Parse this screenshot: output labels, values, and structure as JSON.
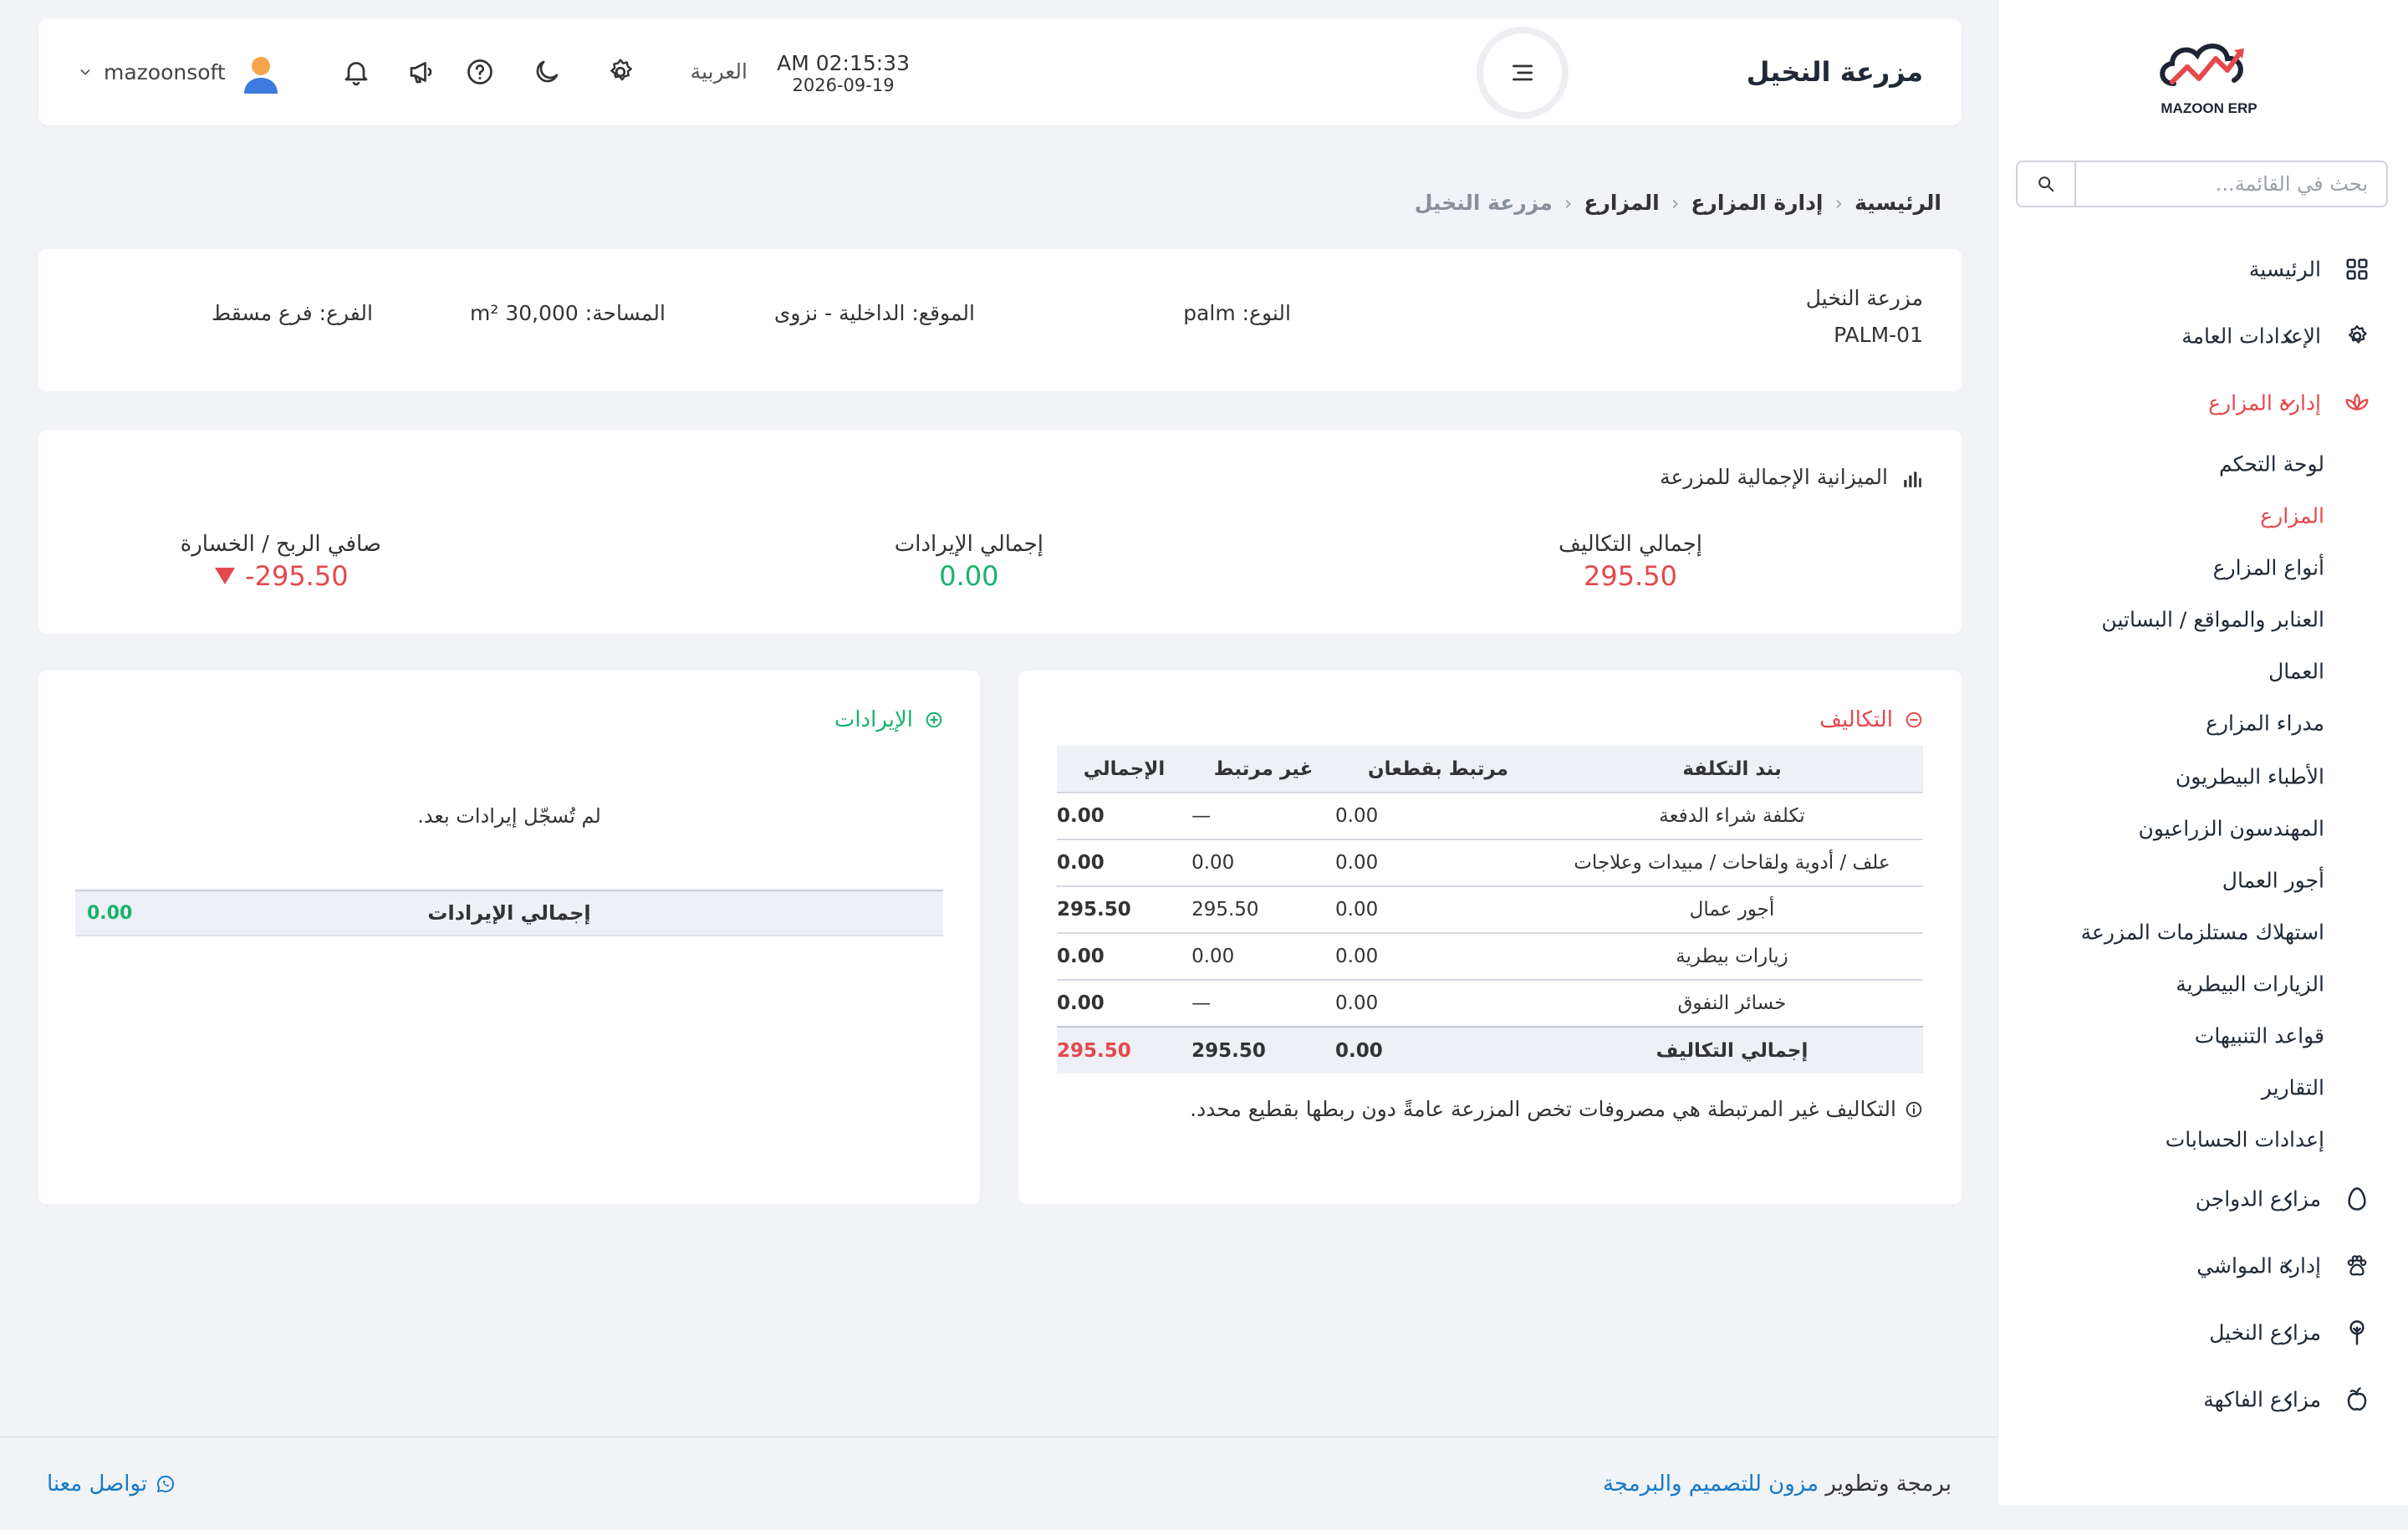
{
  "brand": {
    "logo_text": "MAZOON ERP",
    "accent": "#e5484d"
  },
  "sidebar": {
    "search_placeholder": "بحث في القائمة...",
    "items": [
      {
        "label": "الرئيسية",
        "icon": "grid-icon"
      },
      {
        "label": "الإعدادات العامة",
        "icon": "gear-icon",
        "has_children": true
      },
      {
        "label": "إدارة المزارع",
        "icon": "lotus-icon",
        "expanded": true
      },
      {
        "label": "مزارع الدواجن",
        "icon": "egg-icon",
        "has_children": true
      },
      {
        "label": "إدارة المواشي",
        "icon": "paw-icon",
        "has_children": true
      },
      {
        "label": "مزارع النخيل",
        "icon": "palm-icon",
        "has_children": true
      },
      {
        "label": "مزارع الفاكهة",
        "icon": "fruit-icon",
        "has_children": true
      }
    ],
    "subitems": [
      "لوحة التحكم",
      "المزارع",
      "أنواع المزارع",
      "العنابر والمواقع / البساتين",
      "العمال",
      "مدراء المزارع",
      "الأطباء البيطريون",
      "المهندسون الزراعيون",
      "أجور العمال",
      "استهلاك مستلزمات المزرعة",
      "الزيارات البيطرية",
      "قواعد التنبيهات",
      "التقارير",
      "إعدادات الحسابات"
    ],
    "active_subitem": "المزارع"
  },
  "header": {
    "title": "مزرعة النخيل",
    "time": "AM 02:15:33",
    "date": "2026-09-19",
    "language": "العربية",
    "username": "mazoonsoft"
  },
  "breadcrumb": [
    "الرئيسية",
    "إدارة المزارع",
    "المزارع",
    "مزرعة النخيل"
  ],
  "farm": {
    "name": "مزرعة النخيل",
    "code": "PALM-01",
    "type": "النوع: palm",
    "location": "الموقع: الداخلية - نزوى",
    "area": "المساحة: 30,000 m²",
    "branch": "الفرع: فرع مسقط"
  },
  "budget": {
    "title": "الميزانية الإجمالية للمزرعة",
    "total_costs_label": "إجمالي التكاليف",
    "total_costs": "295.50",
    "total_revenue_label": "إجمالي الإيرادات",
    "total_revenue": "0.00",
    "net_label": "صافي الربح / الخسارة",
    "net": "-295.50"
  },
  "costs": {
    "title": "التكاليف",
    "headers": [
      "بند التكلفة",
      "مرتبط بقطعان",
      "غير مرتبط",
      "الإجمالي"
    ],
    "rows": [
      {
        "item": "تكلفة شراء الدفعة",
        "linked": "0.00",
        "unlinked": "—",
        "total": "0.00"
      },
      {
        "item": "علف / أدوية ولقاحات / مبيدات وعلاجات",
        "linked": "0.00",
        "unlinked": "0.00",
        "total": "0.00"
      },
      {
        "item": "أجور عمال",
        "linked": "0.00",
        "unlinked": "295.50",
        "total": "295.50"
      },
      {
        "item": "زيارات بيطرية",
        "linked": "0.00",
        "unlinked": "0.00",
        "total": "0.00"
      },
      {
        "item": "خسائر النفوق",
        "linked": "0.00",
        "unlinked": "—",
        "total": "0.00"
      }
    ],
    "total_row": {
      "item": "إجمالي التكاليف",
      "linked": "0.00",
      "unlinked": "295.50",
      "total": "295.50"
    },
    "note": "التكاليف غير المرتبطة هي مصروفات تخص المزرعة عامةً دون ربطها بقطيع محدد."
  },
  "revenue": {
    "title": "الإيرادات",
    "empty": "لم تُسجّل إيرادات بعد.",
    "total_label": "إجمالي الإيرادات",
    "total": "0.00"
  },
  "footer": {
    "credit_prefix": "برمجة وتطوير",
    "credit_link": "مزون للتصميم والبرمجة",
    "contact": "تواصل معنا"
  },
  "colors": {
    "red": "#e5484d",
    "green": "#18b26b",
    "link": "#1479c9"
  }
}
